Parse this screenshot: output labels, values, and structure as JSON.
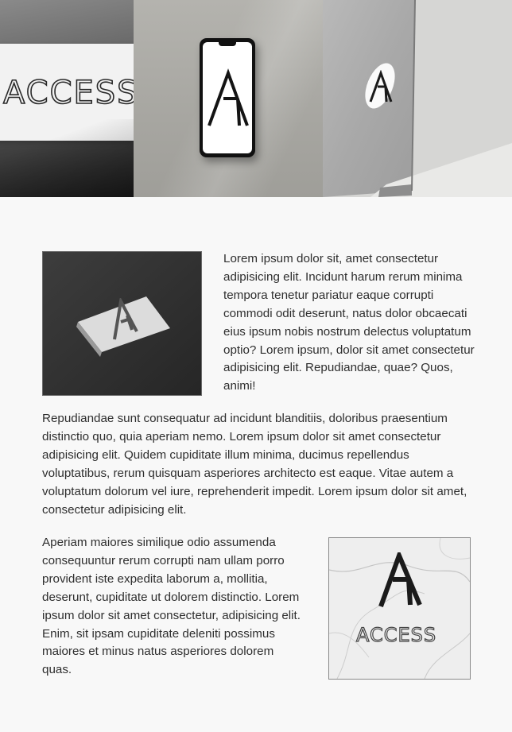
{
  "hero": {
    "panels": [
      {
        "kind": "paper-sign",
        "wordmark": "ACCESS"
      },
      {
        "kind": "phone-mockup",
        "icon": "a-logo-icon"
      },
      {
        "kind": "laptop-sticker",
        "icon": "a-logo-icon"
      }
    ]
  },
  "section1": {
    "image_icon": "a-logo-icon",
    "text": "Lorem ipsum dolor sit, amet consectetur adipisicing elit. Incidunt harum rerum minima tempora tenetur pariatur eaque corrupti commodi odit deserunt, natus dolor obcaecati eius ipsum nobis nostrum delectus voluptatum optio? Lorem ipsum, dolor sit amet consectetur adipisicing elit. Repudiandae, quae? Quos, animi!"
  },
  "section2": {
    "text": "Repudiandae sunt consequatur ad incidunt blanditiis, doloribus praesentium distinctio quo, quia aperiam nemo. Lorem ipsum dolor sit amet consectetur adipisicing elit. Quidem cupiditate illum minima, ducimus repellendus voluptatibus, rerum quisquam asperiores architecto est eaque. Vitae autem a voluptatum dolorum vel iure, reprehenderit impedit. Lorem ipsum dolor sit amet, consectetur adipisicing elit."
  },
  "section3": {
    "text": "Aperiam maiores similique odio assumenda consequuntur rerum corrupti nam ullam porro provident iste expedita laborum a, mollitia, deserunt, cupiditate ut dolorem distinctio. Lorem ipsum dolor sit amet consectetur, adipisicing elit. Enim, sit ipsam cupiditate deleniti possimus maiores et minus natus asperiores dolorem quas.",
    "image_wordmark": "ACCESS",
    "image_icon": "a-logo-icon"
  },
  "colors": {
    "page_background": "#f8f8f8",
    "text": "#2e2e2e",
    "logo": "#1a1a1a"
  }
}
